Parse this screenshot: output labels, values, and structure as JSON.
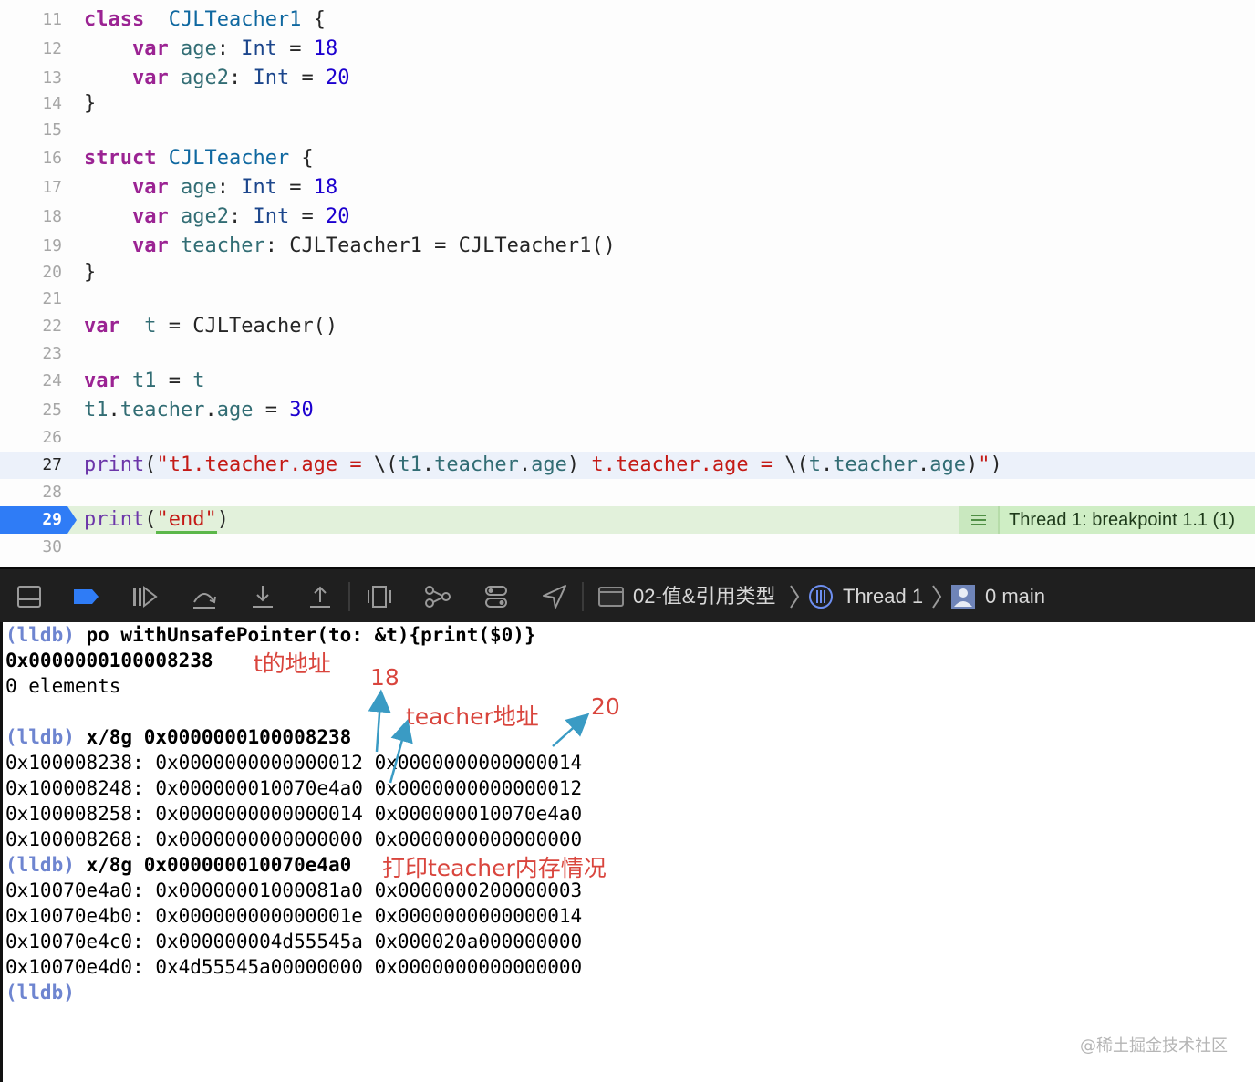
{
  "editor": {
    "lines": [
      {
        "n": "11",
        "code": [
          [
            "kw",
            "class"
          ],
          [
            "",
            "  "
          ],
          [
            "cls",
            "CJLTeacher1"
          ],
          [
            "",
            " {"
          ]
        ]
      },
      {
        "n": "12",
        "code": [
          [
            "",
            "    "
          ],
          [
            "kw",
            "var"
          ],
          [
            "",
            " "
          ],
          [
            "prop",
            "age"
          ],
          [
            "",
            ": "
          ],
          [
            "ty",
            "Int"
          ],
          [
            "",
            " = "
          ],
          [
            "num",
            "18"
          ]
        ]
      },
      {
        "n": "13",
        "code": [
          [
            "",
            "    "
          ],
          [
            "kw",
            "var"
          ],
          [
            "",
            " "
          ],
          [
            "prop",
            "age2"
          ],
          [
            "",
            ": "
          ],
          [
            "ty",
            "Int"
          ],
          [
            "",
            " = "
          ],
          [
            "num",
            "20"
          ]
        ]
      },
      {
        "n": "14",
        "code": [
          [
            "",
            "}"
          ]
        ]
      },
      {
        "n": "15",
        "code": []
      },
      {
        "n": "16",
        "code": [
          [
            "kw",
            "struct"
          ],
          [
            "",
            " "
          ],
          [
            "cls",
            "CJLTeacher"
          ],
          [
            "",
            " {"
          ]
        ]
      },
      {
        "n": "17",
        "code": [
          [
            "",
            "    "
          ],
          [
            "kw",
            "var"
          ],
          [
            "",
            " "
          ],
          [
            "prop",
            "age"
          ],
          [
            "",
            ": "
          ],
          [
            "ty",
            "Int"
          ],
          [
            "",
            " = "
          ],
          [
            "num",
            "18"
          ]
        ]
      },
      {
        "n": "18",
        "code": [
          [
            "",
            "    "
          ],
          [
            "kw",
            "var"
          ],
          [
            "",
            " "
          ],
          [
            "prop",
            "age2"
          ],
          [
            "",
            ": "
          ],
          [
            "ty",
            "Int"
          ],
          [
            "",
            " = "
          ],
          [
            "num",
            "20"
          ]
        ]
      },
      {
        "n": "19",
        "code": [
          [
            "",
            "    "
          ],
          [
            "kw",
            "var"
          ],
          [
            "",
            " "
          ],
          [
            "prop",
            "teacher"
          ],
          [
            "",
            ": CJLTeacher1 = CJLTeacher1()"
          ]
        ]
      },
      {
        "n": "20",
        "code": [
          [
            "",
            "}"
          ]
        ]
      },
      {
        "n": "21",
        "code": []
      },
      {
        "n": "22",
        "code": [
          [
            "kw",
            "var"
          ],
          [
            "",
            "  "
          ],
          [
            "prop",
            "t"
          ],
          [
            "",
            " = CJLTeacher()"
          ]
        ]
      },
      {
        "n": "23",
        "code": []
      },
      {
        "n": "24",
        "code": [
          [
            "kw",
            "var"
          ],
          [
            "",
            " "
          ],
          [
            "prop",
            "t1"
          ],
          [
            "",
            " = "
          ],
          [
            "prop",
            "t"
          ]
        ]
      },
      {
        "n": "25",
        "code": [
          [
            "prop",
            "t1"
          ],
          [
            "",
            "."
          ],
          [
            "prop",
            "teacher"
          ],
          [
            "",
            "."
          ],
          [
            "prop",
            "age"
          ],
          [
            "",
            " = "
          ],
          [
            "num",
            "30"
          ]
        ]
      },
      {
        "n": "26",
        "code": []
      },
      {
        "n": "27",
        "code": [
          [
            "fn",
            "print"
          ],
          [
            "",
            "("
          ],
          [
            "str",
            "\"t1.teacher.age = "
          ],
          [
            "",
            "\\("
          ],
          [
            "prop",
            "t1"
          ],
          [
            "",
            "."
          ],
          [
            "prop",
            "teacher"
          ],
          [
            "",
            "."
          ],
          [
            "prop",
            "age"
          ],
          [
            "",
            ") "
          ],
          [
            "str",
            "t.teacher.age = "
          ],
          [
            "",
            "\\("
          ],
          [
            "prop",
            "t"
          ],
          [
            "",
            "."
          ],
          [
            "prop",
            "teacher"
          ],
          [
            "",
            "."
          ],
          [
            "prop",
            "age"
          ],
          [
            "",
            ")"
          ],
          [
            "str",
            "\""
          ],
          [
            "",
            ")"
          ]
        ]
      },
      {
        "n": "28",
        "code": []
      },
      {
        "n": "29",
        "code": [
          [
            "fn",
            "print"
          ],
          [
            "",
            "("
          ],
          [
            "str",
            "\"end\""
          ],
          [
            "",
            ")"
          ]
        ]
      },
      {
        "n": "30",
        "code": []
      }
    ],
    "breakpoint_label": "Thread 1: breakpoint 1.1 (1)"
  },
  "toolbar": {
    "target": "02-值&引用类型",
    "thread": "Thread 1",
    "frame": "0 main",
    "icons": [
      "hide-debug-area-icon",
      "breakpoints-toggle-icon",
      "continue-icon",
      "step-over-icon",
      "step-into-icon",
      "step-out-icon",
      "view-hierarchy-icon",
      "memory-graph-icon",
      "environment-overrides-icon",
      "simulate-location-icon"
    ]
  },
  "console": {
    "lines": [
      {
        "prompt": "(lldb)",
        "cmd": " po withUnsafePointer(to: &t){print($0)}"
      },
      {
        "text": "0x0000000100008238",
        "bold": true
      },
      {
        "text": "0 elements"
      },
      {
        "text": ""
      },
      {
        "prompt": "(lldb)",
        "cmd": " x/8g 0x0000000100008238"
      },
      {
        "text": "0x100008238: 0x0000000000000012 0x0000000000000014"
      },
      {
        "text": "0x100008248: 0x000000010070e4a0 0x0000000000000012"
      },
      {
        "text": "0x100008258: 0x0000000000000014 0x000000010070e4a0"
      },
      {
        "text": "0x100008268: 0x0000000000000000 0x0000000000000000"
      },
      {
        "prompt": "(lldb)",
        "cmd": " x/8g 0x000000010070e4a0"
      },
      {
        "text": "0x10070e4a0: 0x00000001000081a0 0x0000000200000003"
      },
      {
        "text": "0x10070e4b0: 0x000000000000001e 0x0000000000000014"
      },
      {
        "text": "0x10070e4c0: 0x000000004d55545a 0x000020a000000000"
      },
      {
        "text": "0x10070e4d0: 0x4d55545a00000000 0x0000000000000000"
      },
      {
        "prompt": "(lldb)",
        "cmd": ""
      }
    ],
    "annotations": {
      "t_address": "t的地址",
      "eighteen": "18",
      "teacher_address": "teacher地址",
      "twenty": "20",
      "print_teacher_memory": "打印teacher内存情况"
    },
    "watermark": "@稀土掘金技术社区"
  },
  "colors": {
    "prompt": "#6e85d0",
    "annotation": "#d9453d",
    "arrow": "#3a9bc4",
    "breakpoint": "#2f7cf6"
  }
}
